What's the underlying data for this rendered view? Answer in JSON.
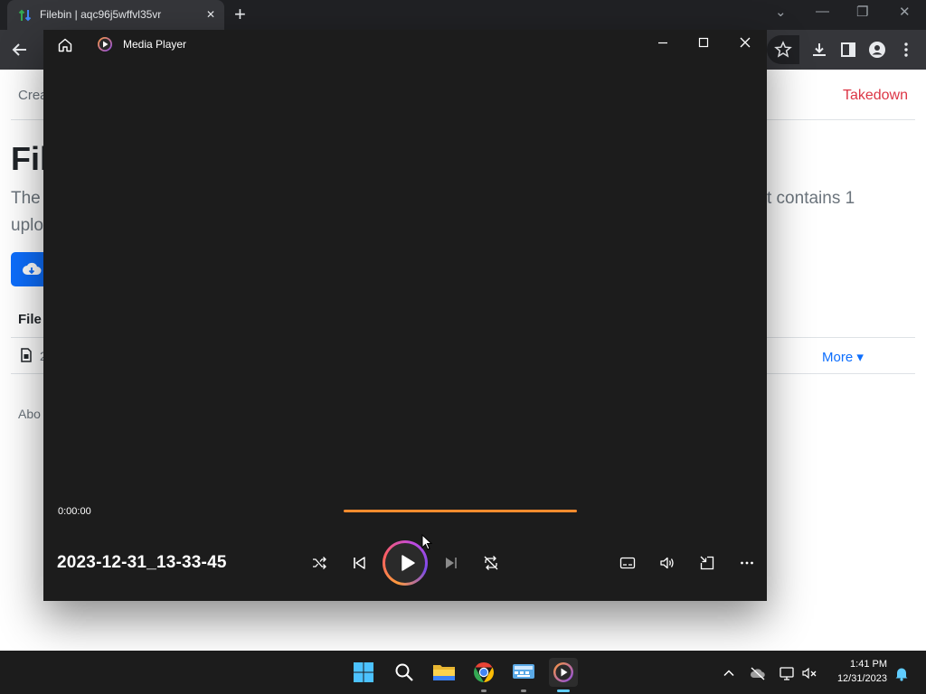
{
  "browser": {
    "tab_title": "Filebin | aqc96j5wffvl35vr",
    "tab_close": "✕",
    "new_tab": "+",
    "window_controls": {
      "dropdown": "⌄",
      "minimize": "—",
      "restore": "❐",
      "close": "✕"
    }
  },
  "page": {
    "nav_left": "Crea",
    "nav_right": "Takedown",
    "heading": "Fil",
    "lead_line1": "The",
    "lead_line2": "uplo",
    "lead_right": "t contains 1",
    "files_heading": "File",
    "file_row_text": "2",
    "more_label": "More ▾",
    "about": "Abo"
  },
  "player": {
    "title": "Media Player",
    "current_time": "0:00:00",
    "progress": 0,
    "filename": "2023-12-31_13-33-45",
    "accent": "#ff8c2e",
    "icons": [
      "home-icon",
      "shuffle-icon",
      "previous-icon",
      "play-icon",
      "next-icon",
      "repeat-icon",
      "captions-icon",
      "volume-icon",
      "miniplayer-icon",
      "more-icon"
    ]
  },
  "taskbar": {
    "apps": [
      "start-icon",
      "search-icon",
      "file-explorer-icon",
      "chrome-icon",
      "keyboard-app-icon",
      "media-player-icon"
    ],
    "clock_time": "1:41 PM",
    "clock_date": "12/31/2023"
  }
}
